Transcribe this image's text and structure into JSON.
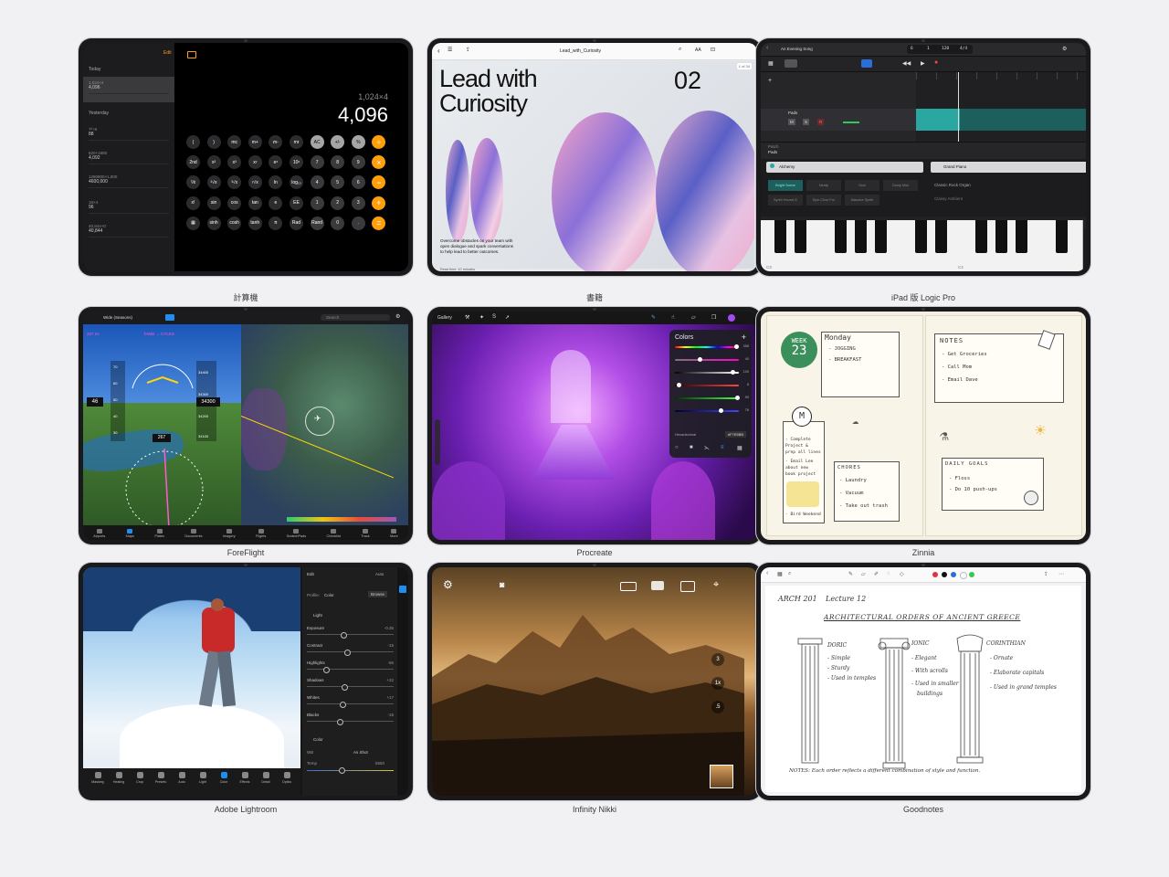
{
  "captions": {
    "calculator": "計算機",
    "books": "書籍",
    "logic": "iPad 版 Logic Pro",
    "foreflight": "ForeFlight",
    "procreate": "Procreate",
    "zinnia": "Zinnia",
    "lightroom": "Adobe Lightroom",
    "nikki": "Infinity Nikki",
    "goodnotes": "Goodnotes"
  },
  "calculator": {
    "edit": "Edit",
    "section_today": "Today",
    "section_yesterday": "Yesterday",
    "history": [
      {
        "expr": "1,024×4",
        "result": "4,096"
      },
      {
        "expr": "7²÷8",
        "result": "88"
      },
      {
        "expr": "520+1680",
        "result": "4,092"
      },
      {
        "expr": "1280800×1,800",
        "result": "4600,000"
      },
      {
        "expr": "16×4",
        "result": "96"
      },
      {
        "expr": "40,844+0",
        "result": "40,844"
      }
    ],
    "expression": "1,024×4",
    "result": "4,096",
    "keys": [
      [
        "(",
        ")",
        "mc",
        "m+",
        "m-",
        "mr",
        "AC",
        "+/-",
        "%",
        "÷"
      ],
      [
        "2nd",
        "x²",
        "x³",
        "xʸ",
        "eˣ",
        "10ˣ",
        "7",
        "8",
        "9",
        "×"
      ],
      [
        "⅟x",
        "²√x",
        "³√x",
        "ʸ√x",
        "ln",
        "log₁₀",
        "4",
        "5",
        "6",
        "−"
      ],
      [
        "x!",
        "sin",
        "cos",
        "tan",
        "e",
        "EE",
        "1",
        "2",
        "3",
        "+"
      ],
      [
        "▦",
        "sinh",
        "cosh",
        "tanh",
        "π",
        "Rad",
        "Rand",
        "0",
        ".",
        "="
      ]
    ]
  },
  "books": {
    "doc_title": "Lead_with_Curiosity",
    "page_badge": "1 of 34",
    "heading_line1": "Lead with",
    "heading_line2": "Curiosity",
    "number": "02",
    "body": "Overcome obstacles on your team with open dialogue and spark conversations to help lead to better outcomes.",
    "footnote": "Read time: 10 minutes"
  },
  "logic": {
    "song": "An Evening Song",
    "bar": "6",
    "beat": "1",
    "tempo": "128",
    "signature": "4/4",
    "track": "Pads",
    "patch_label": "Patch",
    "patch": "Pads",
    "library_left": "Alchemy",
    "library_right": "Grand Piano",
    "presets_left": [
      "Bright Scene",
      "Nerdy",
      "Soul",
      "Dusty Mist",
      "Synth Hound G",
      "Epic Choir For",
      "Massive Synth"
    ],
    "presets_right": [
      "Classic Rock Organ",
      "Classy Ambient"
    ],
    "footer_left": "Reset & Forgotten",
    "footer_right": "Revisit",
    "key_c3": "C3",
    "key_c4": "C4"
  },
  "foreflight": {
    "chart_mode": "Wide (Seasons)",
    "gps_alt": "237 mi",
    "route": "TAMB → CYLES",
    "speed": "46",
    "altitude": "34300",
    "heading": "267",
    "alt_ticks": [
      "70",
      "60",
      "50",
      "40",
      "30"
    ],
    "alt_scale": [
      "34400",
      "34300",
      "34200",
      "34100"
    ],
    "search": "Search",
    "tabs": [
      "Airports",
      "Maps",
      "Plates",
      "Documents",
      "Imagery",
      "Flights",
      "ScratchPads",
      "Checklist",
      "Track",
      "More"
    ]
  },
  "procreate": {
    "gallery": "Gallery",
    "panel_title": "Colors",
    "hex_label": "Hexadecimal",
    "hex_value": "#F7E5BB",
    "slider_values": [
      "358",
      "40",
      "100",
      "8",
      "99",
      "76"
    ]
  },
  "zinnia": {
    "week_label": "WEEK",
    "week_number": "23",
    "day": "Monday",
    "day_items": [
      "- JOGGING",
      "- BREAKFAST"
    ],
    "notes_title": "NOTES",
    "notes_items": [
      "- Get Groceries",
      "- Call Mom",
      "- Email Dave"
    ],
    "m_label": "M",
    "m_items": [
      "- Complete",
      "Project &",
      "prep all lines",
      "- Email Lee",
      "about new",
      "book project"
    ],
    "m_footer": "- Bird Weekend",
    "chores_title": "CHORES",
    "chores_items": [
      "- Laundry",
      "- Vacuum",
      "- Take out trash"
    ],
    "goals_title": "DAILY GOALS",
    "goals_items": [
      "- Floss",
      "- Do 10 push-ups"
    ]
  },
  "lightroom": {
    "edit": "Edit",
    "auto": "Auto",
    "profile_label": "Profile:",
    "profile_value": "Color",
    "browse": "Browse",
    "light_section": "Light",
    "sliders": [
      {
        "label": "Exposure",
        "value": "-0.35",
        "pos": 0.42
      },
      {
        "label": "Contrast",
        "value": "-15",
        "pos": 0.46
      },
      {
        "label": "Highlights",
        "value": "-56",
        "pos": 0.22
      },
      {
        "label": "Shadows",
        "value": "+22",
        "pos": 0.43
      },
      {
        "label": "Whites",
        "value": "+17",
        "pos": 0.41
      },
      {
        "label": "Blacks",
        "value": "-15",
        "pos": 0.38
      }
    ],
    "color_section": "Color",
    "wb_label": "WB",
    "wb_value": "As Shot",
    "temp_label": "Temp",
    "temp_value": "5550",
    "tools": [
      "Masking",
      "Healing",
      "Crop",
      "Presets",
      "Auto",
      "Light",
      "Color",
      "Effects",
      "Detail",
      "Optics"
    ]
  },
  "nikki": {
    "controls": [
      "3",
      "1x",
      ".5"
    ]
  },
  "goodnotes": {
    "course": "ARCH 201",
    "lecture": "Lecture 12",
    "title": "ARCHITECTURAL ORDERS OF ANCIENT GREECE",
    "doric": "DORIC",
    "doric_items": [
      "- Simple",
      "- Sturdy",
      "- Used in temples"
    ],
    "ionic": "IONIC",
    "ionic_items": [
      "- Elegant",
      "- With scrolls",
      "- Used in smaller",
      "buildings"
    ],
    "corinthian": "CORINTHIAN",
    "corinthian_items": [
      "- Ornate",
      "- Elaborate capitals",
      "- Used in grand temples"
    ],
    "notes": "NOTES: Each order reflects a different combination of style and function."
  },
  "colors": {
    "calc_orange": "#ff9f0a",
    "logic_teal": "#2aa7a0",
    "ff_blue": "#1e8ef0",
    "procreate_purple": "#a24bf0"
  }
}
